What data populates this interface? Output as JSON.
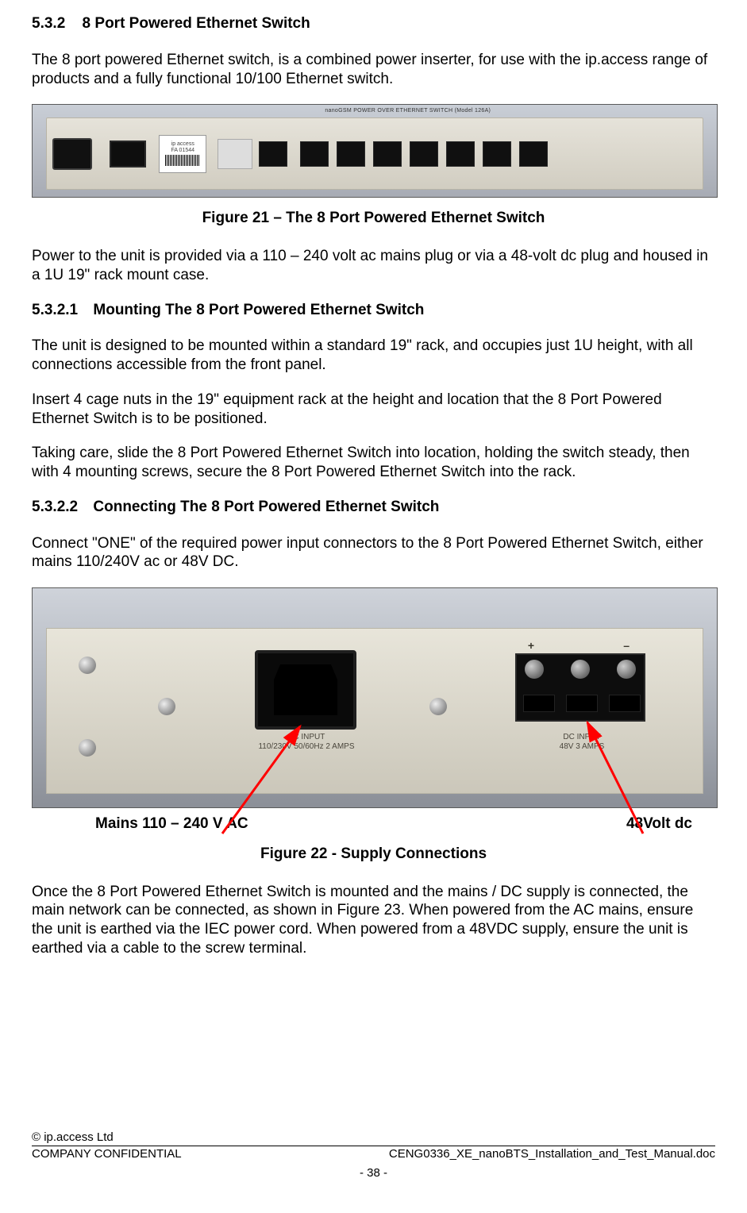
{
  "section": {
    "h3_num": "5.3.2",
    "h3_title": "8 Port Powered Ethernet Switch",
    "p1": "The 8 port powered Ethernet switch, is a combined power inserter, for use with the ip.access range of products and a fully functional 10/100 Ethernet switch.",
    "fig21_caption": "Figure 21 – The 8 Port Powered Ethernet Switch",
    "fig21_sticker_top": "ip access",
    "fig21_sticker_id": "FA 01544",
    "fig21_top_label": "nanoGSM  POWER OVER ETHERNET SWITCH  (Model 126A)",
    "p2": "Power to the unit is provided via a 110 – 240 volt ac mains plug or via a 48-volt dc plug and housed in a 1U 19\" rack mount case.",
    "h4a_num": "5.3.2.1",
    "h4a_title": "Mounting The 8 Port Powered Ethernet Switch",
    "p3": "The unit is designed to be mounted within a standard 19\" rack, and occupies just 1U height, with all connections accessible from the front panel.",
    "p4": "Insert 4 cage nuts in the 19\" equipment rack at the height and location that the 8 Port Powered Ethernet Switch is to be positioned.",
    "p5": "Taking care, slide the 8 Port Powered Ethernet Switch into location, holding the switch steady, then with 4 mounting screws, secure the 8 Port Powered Ethernet Switch into the rack.",
    "h4b_num": "5.3.2.2",
    "h4b_title": "Connecting The 8 Port Powered Ethernet Switch",
    "p6": "Connect \"ONE\" of the required power input connectors to the 8 Port Powered Ethernet Switch, either mains 110/240V ac or  48V DC.",
    "fig22_ac_label_line1": "AC INPUT",
    "fig22_ac_label_line2": "110/230V 50/60Hz 2 AMPS",
    "fig22_dc_label_line1": "DC INPUT",
    "fig22_dc_label_line2": "48V 3 AMPS",
    "fig22_plus": "+",
    "fig22_minus": "–",
    "callout_left": "Mains 110 – 240 V AC",
    "callout_right": "48Volt dc",
    "fig22_caption": "Figure 22 - Supply Connections",
    "p7": "Once the 8 Port Powered Ethernet Switch is mounted and the mains / DC supply is connected, the main network can be connected, as shown in Figure 23. When powered from the AC mains, ensure the unit is earthed via the IEC power cord. When powered from a 48VDC supply, ensure the unit is earthed via a cable to the screw terminal."
  },
  "footer": {
    "copyright": "© ip.access Ltd",
    "confidential": "COMPANY CONFIDENTIAL",
    "docname": "CENG0336_XE_nanoBTS_Installation_and_Test_Manual.doc",
    "page": "- 38 -"
  }
}
